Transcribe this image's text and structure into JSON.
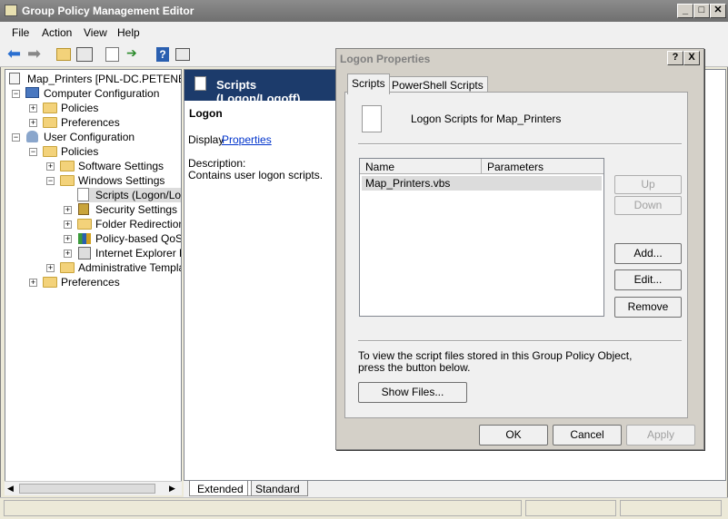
{
  "window": {
    "title": "Group Policy Management Editor"
  },
  "menu": [
    "File",
    "Action",
    "View",
    "Help"
  ],
  "tree": {
    "root": "Map_Printers [PNL-DC.PETENETLIV",
    "computer_config": "Computer Configuration",
    "cc_policies": "Policies",
    "cc_preferences": "Preferences",
    "user_config": "User Configuration",
    "uc_policies": "Policies",
    "software_settings": "Software Settings",
    "windows_settings": "Windows Settings",
    "scripts": "Scripts (Logon/Logo",
    "security_settings": "Security Settings",
    "folder_redirection": "Folder Redirection",
    "policy_qos": "Policy-based QoS",
    "ie_maint": "Internet Explorer M",
    "admin_templates": "Administrative Templat",
    "uc_preferences": "Preferences"
  },
  "right": {
    "header": "Scripts (Logon/Logoff)",
    "section": "Logon",
    "display_prefix": "Display",
    "properties_link": "Properties",
    "desc_label": "Description:",
    "desc_text": "Contains user logon scripts."
  },
  "bottom_tabs": [
    "Extended",
    "Standard"
  ],
  "dialog": {
    "title": "Logon Properties",
    "help_btn": "?",
    "close_btn": "X",
    "tabs": [
      "Scripts",
      "PowerShell Scripts"
    ],
    "heading": "Logon Scripts for Map_Printers",
    "col_name": "Name",
    "col_params": "Parameters",
    "rows": [
      {
        "name": "Map_Printers.vbs",
        "params": ""
      }
    ],
    "up": "Up",
    "down": "Down",
    "add": "Add...",
    "edit": "Edit...",
    "remove": "Remove",
    "info": "To view the script files stored in this Group Policy Object, press the button below.",
    "show_files": "Show Files...",
    "ok": "OK",
    "cancel": "Cancel",
    "apply": "Apply"
  }
}
